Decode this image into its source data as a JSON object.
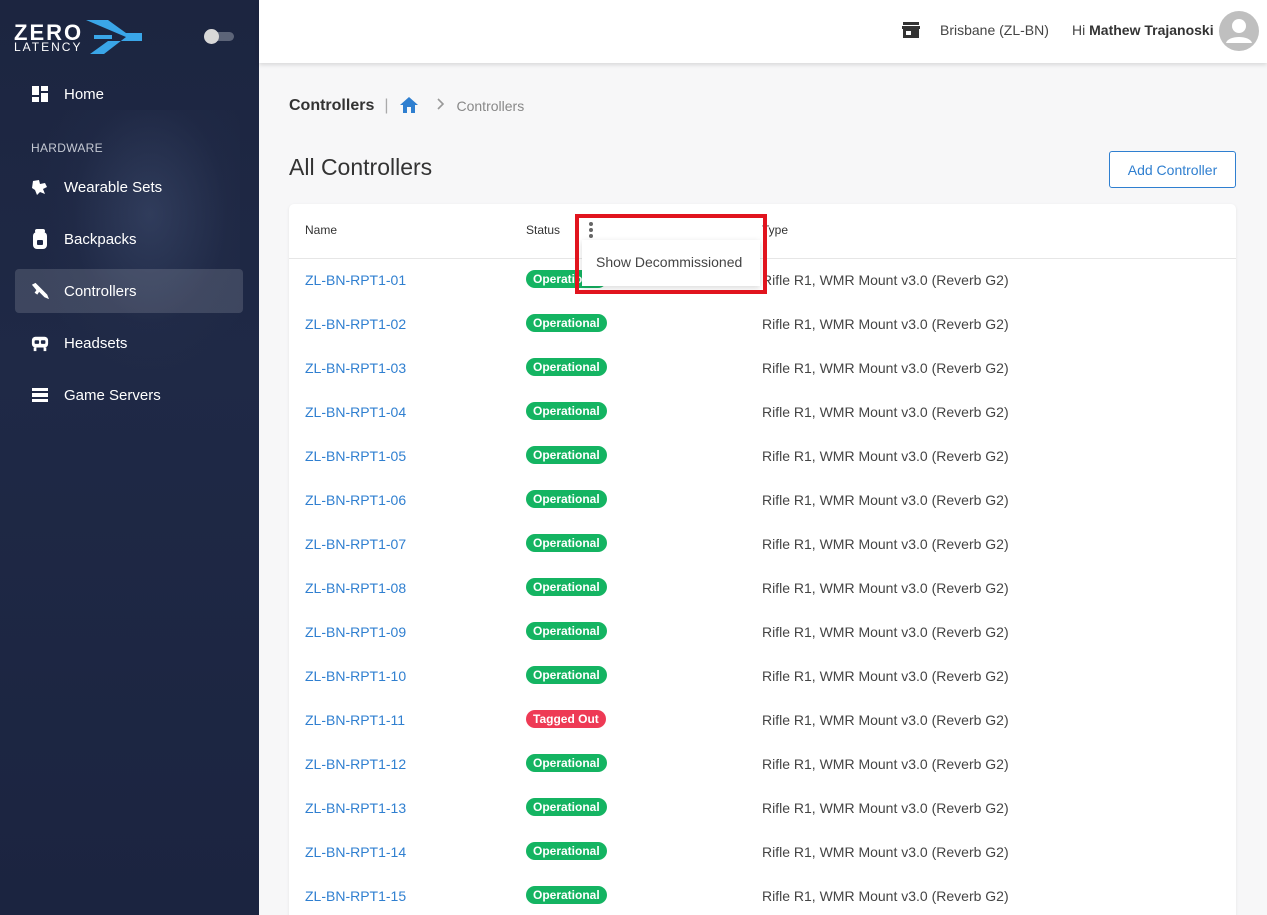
{
  "brand": {
    "line1": "ZERO",
    "line2": "LATENCY"
  },
  "sidebar": {
    "section_label": "HARDWARE",
    "items": [
      {
        "label": "Home",
        "icon": "dashboard-icon"
      },
      {
        "label": "Wearable Sets",
        "icon": "wearable-icon"
      },
      {
        "label": "Backpacks",
        "icon": "backpack-icon"
      },
      {
        "label": "Controllers",
        "icon": "controller-icon",
        "active": true
      },
      {
        "label": "Headsets",
        "icon": "headset-icon"
      },
      {
        "label": "Game Servers",
        "icon": "server-icon"
      }
    ]
  },
  "topbar": {
    "location": "Brisbane (ZL-BN)",
    "greeting": "Hi",
    "user": "Mathew Trajanoski"
  },
  "breadcrumb": {
    "title": "Controllers",
    "current": "Controllers"
  },
  "page": {
    "title": "All Controllers",
    "add_button": "Add Controller"
  },
  "table": {
    "columns": [
      "Name",
      "Status",
      "Type"
    ],
    "menu_item": "Show Decommissioned",
    "rows": [
      {
        "name": "ZL-BN-RPT1-01",
        "status": "Operational",
        "type": "Rifle R1, WMR Mount v3.0 (Reverb G2)"
      },
      {
        "name": "ZL-BN-RPT1-02",
        "status": "Operational",
        "type": "Rifle R1, WMR Mount v3.0 (Reverb G2)"
      },
      {
        "name": "ZL-BN-RPT1-03",
        "status": "Operational",
        "type": "Rifle R1, WMR Mount v3.0 (Reverb G2)"
      },
      {
        "name": "ZL-BN-RPT1-04",
        "status": "Operational",
        "type": "Rifle R1, WMR Mount v3.0 (Reverb G2)"
      },
      {
        "name": "ZL-BN-RPT1-05",
        "status": "Operational",
        "type": "Rifle R1, WMR Mount v3.0 (Reverb G2)"
      },
      {
        "name": "ZL-BN-RPT1-06",
        "status": "Operational",
        "type": "Rifle R1, WMR Mount v3.0 (Reverb G2)"
      },
      {
        "name": "ZL-BN-RPT1-07",
        "status": "Operational",
        "type": "Rifle R1, WMR Mount v3.0 (Reverb G2)"
      },
      {
        "name": "ZL-BN-RPT1-08",
        "status": "Operational",
        "type": "Rifle R1, WMR Mount v3.0 (Reverb G2)"
      },
      {
        "name": "ZL-BN-RPT1-09",
        "status": "Operational",
        "type": "Rifle R1, WMR Mount v3.0 (Reverb G2)"
      },
      {
        "name": "ZL-BN-RPT1-10",
        "status": "Operational",
        "type": "Rifle R1, WMR Mount v3.0 (Reverb G2)"
      },
      {
        "name": "ZL-BN-RPT1-11",
        "status": "Tagged Out",
        "type": "Rifle R1, WMR Mount v3.0 (Reverb G2)"
      },
      {
        "name": "ZL-BN-RPT1-12",
        "status": "Operational",
        "type": "Rifle R1, WMR Mount v3.0 (Reverb G2)"
      },
      {
        "name": "ZL-BN-RPT1-13",
        "status": "Operational",
        "type": "Rifle R1, WMR Mount v3.0 (Reverb G2)"
      },
      {
        "name": "ZL-BN-RPT1-14",
        "status": "Operational",
        "type": "Rifle R1, WMR Mount v3.0 (Reverb G2)"
      },
      {
        "name": "ZL-BN-RPT1-15",
        "status": "Operational",
        "type": "Rifle R1, WMR Mount v3.0 (Reverb G2)"
      }
    ]
  },
  "colors": {
    "sidebar": "#1f2946",
    "accent": "#2f7fd0",
    "operational": "#14b462",
    "tagged_out": "#ee3a55",
    "highlight": "#e1141e"
  }
}
